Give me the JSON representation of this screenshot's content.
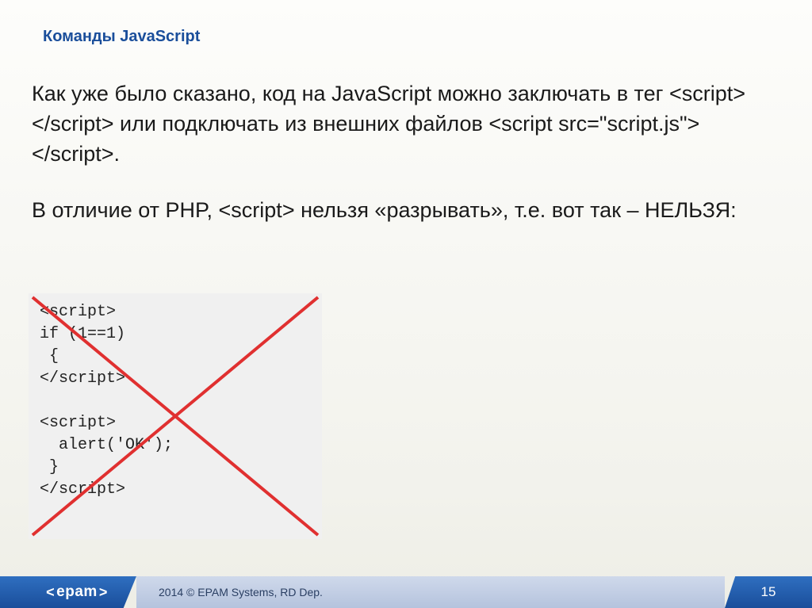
{
  "slide": {
    "title": "Команды JavaScript",
    "paragraph1": "Как уже было сказано, код на JavaScript можно заключать в тег <script></script> или подключать из внешних файлов <script src=\"script.js\"></script>.",
    "paragraph2": "В отличие от PHP, <script> нельзя «разрывать», т.е. вот так – НЕЛЬЗЯ:",
    "code": "<script>\nif (1==1)\n {\n</script>\n\n<script>\n  alert('OK');\n }\n</script>"
  },
  "footer": {
    "logo_text": "epam",
    "copyright": "2014 © EPAM Systems, RD Dep.",
    "page_number": "15"
  },
  "colors": {
    "cross": "#e03030",
    "title": "#1a4e9b"
  }
}
